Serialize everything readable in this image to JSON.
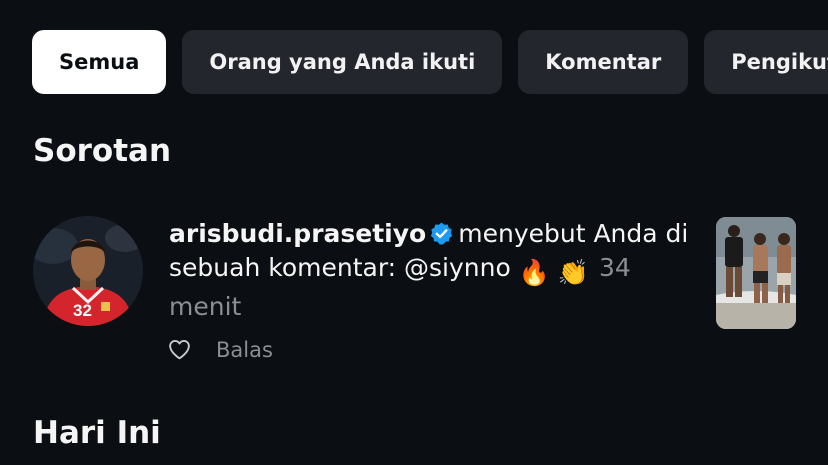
{
  "filters": [
    {
      "label": "Semua",
      "active": true
    },
    {
      "label": "Orang yang Anda ikuti",
      "active": false
    },
    {
      "label": "Komentar",
      "active": false
    },
    {
      "label": "Pengikut",
      "active": false
    }
  ],
  "sections": {
    "highlights_title": "Sorotan",
    "today_title": "Hari Ini"
  },
  "notification": {
    "username": "arisbudi.prasetiyo",
    "verified": true,
    "message": "menyebut Anda di sebuah komentar: @siynno",
    "emoji_1": "🔥",
    "emoji_2": "👏",
    "time": "34 menit",
    "like_icon": "heart-icon",
    "reply_label": "Balas"
  },
  "colors": {
    "background": "#0b0e12",
    "chip": "#23272d",
    "chip_active": "#ffffff",
    "verified": "#1d9bf0",
    "muted": "#8a8f96"
  }
}
